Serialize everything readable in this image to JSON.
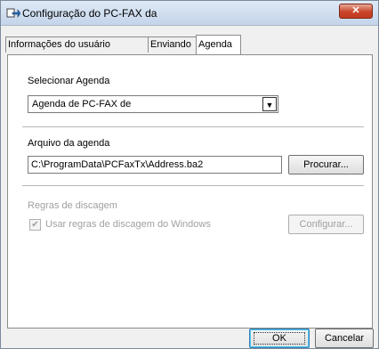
{
  "window": {
    "title": "Configuração do PC-FAX da",
    "close_label": "✕"
  },
  "tabs": [
    {
      "label": "Informações do usuário",
      "active": false
    },
    {
      "label": "Enviando",
      "active": false
    },
    {
      "label": "Agenda",
      "active": true
    }
  ],
  "agenda": {
    "select_label": "Selecionar Agenda",
    "selected_value": "Agenda de PC-FAX de",
    "file_label": "Arquivo da agenda",
    "file_path": "C:\\ProgramData\\PCFaxTx\\Address.ba2",
    "browse_label": "Procurar..."
  },
  "dialing": {
    "section_label": "Regras de discagem",
    "checkbox_label": "Usar regras de discagem do Windows",
    "checkbox_checked": true,
    "configure_label": "Configurar..."
  },
  "footer": {
    "ok_label": "OK",
    "cancel_label": "Cancelar"
  },
  "icons": {
    "title_icon": "fax-arrow-icon",
    "dropdown": "dropdown-arrow-icon"
  }
}
